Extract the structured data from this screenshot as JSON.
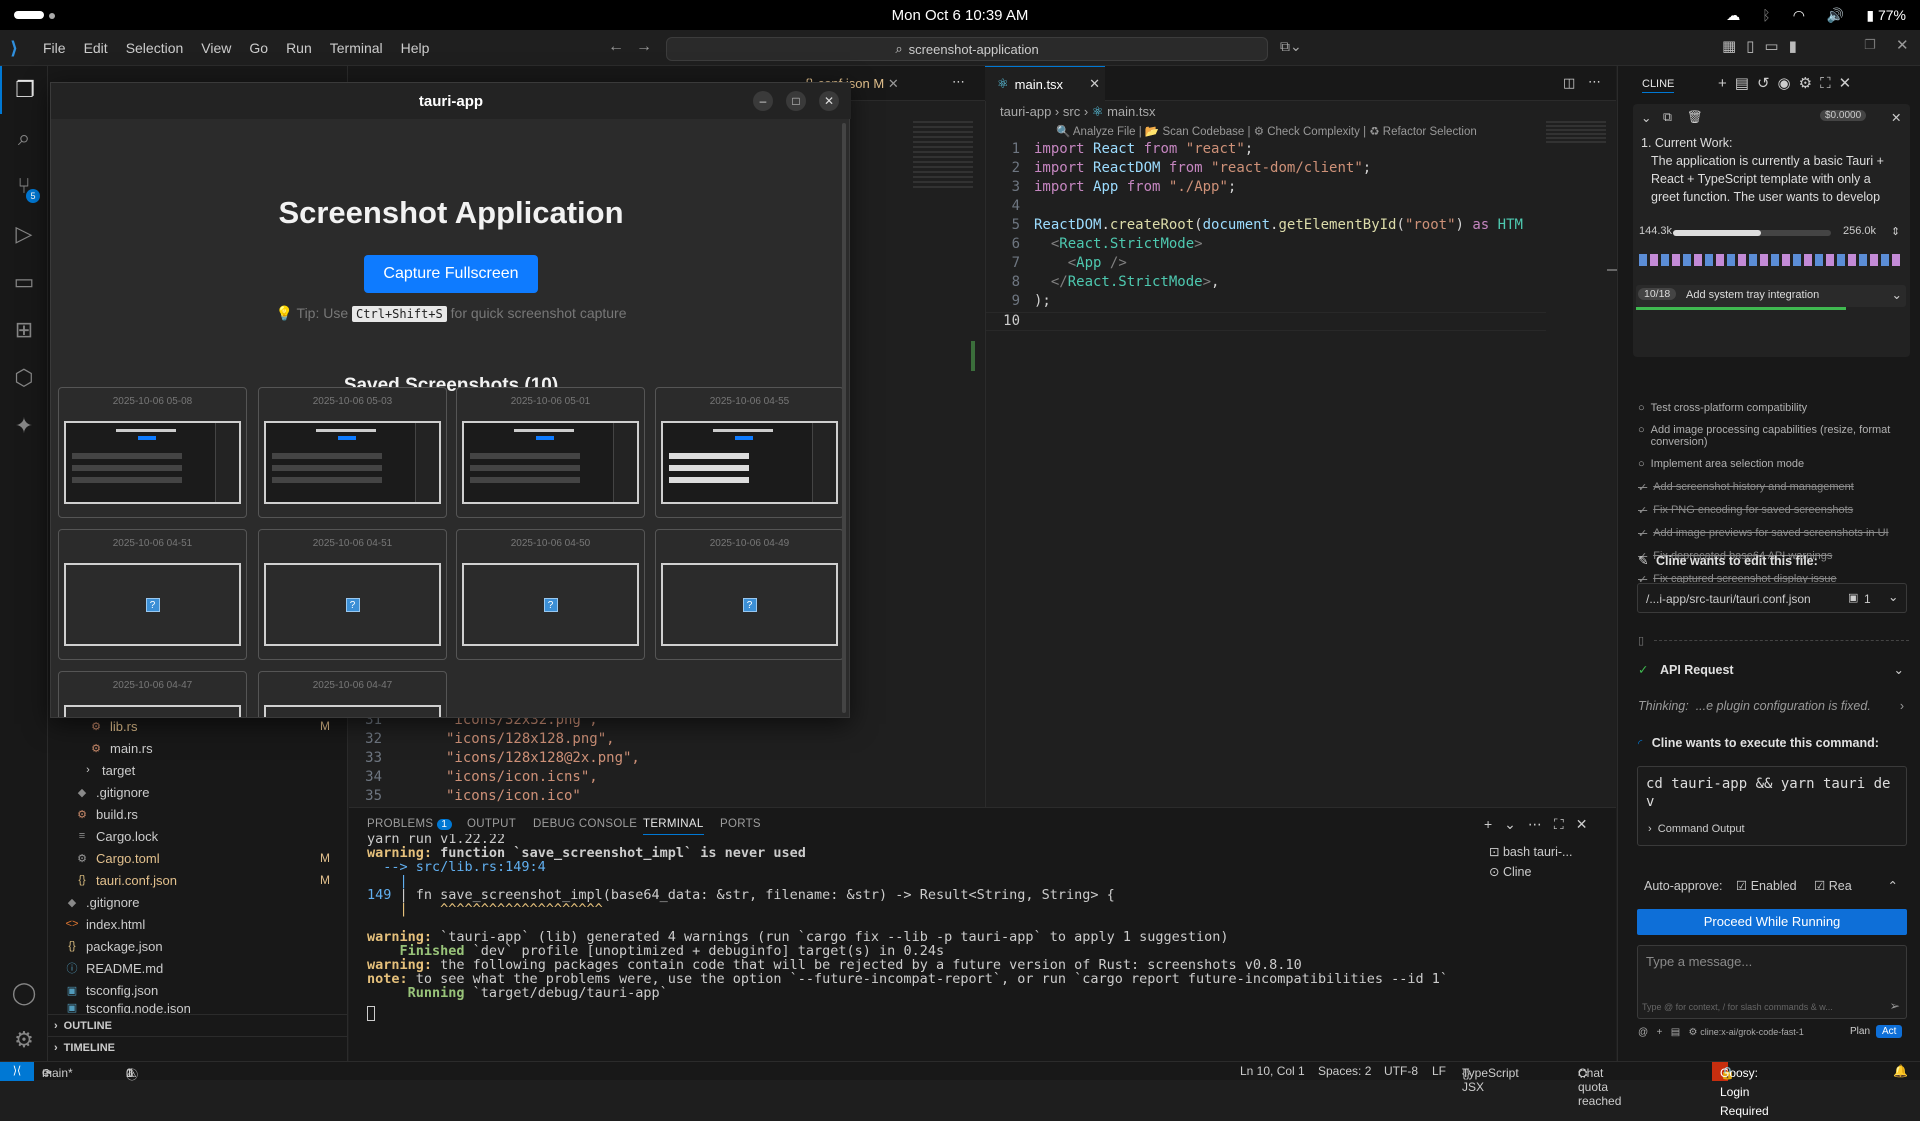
{
  "system": {
    "datetime": "Mon Oct 6  10:39 AM",
    "battery": "77%"
  },
  "menu": [
    "File",
    "Edit",
    "Selection",
    "View",
    "Go",
    "Run",
    "Terminal",
    "Help"
  ],
  "search": {
    "text": "screenshot-application"
  },
  "explorer": {
    "files": [
      {
        "name": "lib.rs",
        "mod": "M",
        "icon": "rust-icon"
      },
      {
        "name": "main.rs",
        "mod": "",
        "icon": "rust-icon"
      },
      {
        "name": "target",
        "mod": "",
        "icon": "folder-chevron"
      },
      {
        "name": ".gitignore",
        "mod": "",
        "icon": "git-icon"
      },
      {
        "name": "build.rs",
        "mod": "",
        "icon": "rust-icon"
      },
      {
        "name": "Cargo.lock",
        "mod": "",
        "icon": "lines-icon"
      },
      {
        "name": "Cargo.toml",
        "mod": "M",
        "icon": "gear-icon"
      },
      {
        "name": "tauri.conf.json",
        "mod": "M",
        "icon": "json-icon"
      },
      {
        "name": ".gitignore",
        "mod": "",
        "icon": "git-icon"
      },
      {
        "name": "index.html",
        "mod": "",
        "icon": "html-icon"
      },
      {
        "name": "package.json",
        "mod": "",
        "icon": "json-icon"
      },
      {
        "name": "README.md",
        "mod": "",
        "icon": "info-icon"
      },
      {
        "name": "tsconfig.json",
        "mod": "",
        "icon": "ts-icon"
      },
      {
        "name": "tsconfig.node.json",
        "mod": "",
        "icon": "ts-icon"
      }
    ],
    "outline": "OUTLINE",
    "timeline": "TIMELINE"
  },
  "editor_left": {
    "tab": "conf.json",
    "tab_mod": "M",
    "lines": [
      {
        "n": "31",
        "text": "\"icons/32x32.png\","
      },
      {
        "n": "32",
        "text": "\"icons/128x128.png\","
      },
      {
        "n": "33",
        "text": "\"icons/128x128@2x.png\","
      },
      {
        "n": "34",
        "text": "\"icons/icon.icns\","
      },
      {
        "n": "35",
        "text": "\"icons/icon.ico\""
      }
    ]
  },
  "editor_right": {
    "tab": "main.tsx",
    "breadcrumb": [
      "tauri-app",
      "src",
      "main.tsx"
    ],
    "codelens": [
      "Analyze File",
      "Scan Codebase",
      "Check Complexity",
      "Refactor Selection"
    ],
    "line_numbers": [
      "1",
      "2",
      "3",
      "4",
      "5",
      "6",
      "7",
      "8",
      "9",
      "10"
    ]
  },
  "panel": {
    "tabs": [
      "PROBLEMS",
      "OUTPUT",
      "DEBUG CONSOLE",
      "TERMINAL",
      "PORTS"
    ],
    "problems_count": "1",
    "terminals": [
      "bash  tauri-...",
      "Cline"
    ],
    "lines": {
      "l0": "yarn run v1.22.22",
      "l1a": "warning:",
      "l1b": " function `save_screenshot_impl` is never used",
      "l2": "  --> src/lib.rs:149:4",
      "l3": "    |",
      "l4n": "149",
      "l4": " | fn save_screenshot_impl(base64_data: &str, filename: &str) -> Result<String, String> {",
      "l5": "    |    ^^^^^^^^^^^^^^^^^^^^",
      "l6a": "warning:",
      "l6b": " `tauri-app` (lib) generated 4 warnings (run `cargo fix --lib -p tauri-app` to apply 1 suggestion)",
      "l7a": "    Finished",
      "l7b": " `dev` profile [unoptimized + debuginfo] target(s) in 0.24s",
      "l8a": "warning:",
      "l8b": " the following packages contain code that will be rejected by a future version of Rust: screenshots v0.8.10",
      "l9a": "note:",
      "l9b": " to see what the problems were, use the option `--future-incompat-report`, or run `cargo report future-incompatibilities --id 1`",
      "l10a": "     Running",
      "l10b": " `target/debug/tauri-app`"
    }
  },
  "tauri": {
    "title": "tauri-app",
    "heading": "Screenshot Application",
    "capture_button": "Capture Fullscreen",
    "tip_prefix": "💡 Tip: Use",
    "tip_key": "Ctrl+Shift+S",
    "tip_suffix": "for quick screenshot capture",
    "saved_heading": "Saved Screenshots (10)",
    "shots": [
      "2025-10-06 05-08",
      "2025-10-06 05-03",
      "2025-10-06 05-01",
      "2025-10-06 04-55",
      "2025-10-06 04-51",
      "2025-10-06 04-51",
      "2025-10-06 04-50",
      "2025-10-06 04-49",
      "2025-10-06 04-47",
      "2025-10-06 04-47"
    ]
  },
  "cline": {
    "title": "CLINE",
    "cost": "$0.0000",
    "task_title": "1. Current Work:",
    "task_text": "The application is currently a basic Tauri + React + TypeScript template with only a greet function. The user wants to develop",
    "tokens_used": "144.3k",
    "tokens_max": "256.0k",
    "context_fraction": 0.56,
    "todo_progress": "10/18",
    "todo_title": "Add system tray integration",
    "todos": [
      {
        "text": "Test cross-platform compatibility",
        "done": false
      },
      {
        "text": "Add image processing capabilities (resize, format conversion)",
        "done": false
      },
      {
        "text": "Implement area selection mode",
        "done": false
      },
      {
        "text": "Add screenshot history and management",
        "done": true
      },
      {
        "text": "Fix PNG encoding for saved screenshots",
        "done": true
      },
      {
        "text": "Add image previews for saved screenshots in UI",
        "done": true
      },
      {
        "text": "Fix deprecated base64 API warnings",
        "done": true
      },
      {
        "text": "Fix captured screenshot display issue",
        "done": true
      }
    ],
    "edit_label": "Cline wants to edit this file:",
    "edit_file": "/...i-app/src-tauri/tauri.conf.json",
    "edit_count": "1",
    "api_request": "API Request",
    "thinking_label": "Thinking:",
    "thinking_text": "...e plugin configuration is fixed.",
    "execute_label": "Cline wants to execute this command:",
    "command": "cd tauri-app && yarn tauri dev",
    "command_output": "Command Output",
    "auto_approve": "Auto-approve:",
    "enabled": "Enabled",
    "rea": "Rea",
    "proceed": "Proceed While Running",
    "msg_placeholder": "Type a message...",
    "msg_hint": "Type @ for context, / for slash commands & w...",
    "model": "cline:x-ai/grok-code-fast-1",
    "plan": "Plan",
    "act": "Act"
  },
  "statusbar": {
    "branch": "main*",
    "errors": "0",
    "warnings": "1",
    "position": "Ln 10, Col 1",
    "spaces": "Spaces: 2",
    "encoding": "UTF-8",
    "eol": "LF",
    "language": "TypeScript JSX",
    "quota": "Chat quota reached",
    "goosy": "Goosy: Login Required"
  },
  "colors": {
    "accent": "#0078d4",
    "button_blue": "#0e7bff",
    "warning": "#e2c08d"
  }
}
